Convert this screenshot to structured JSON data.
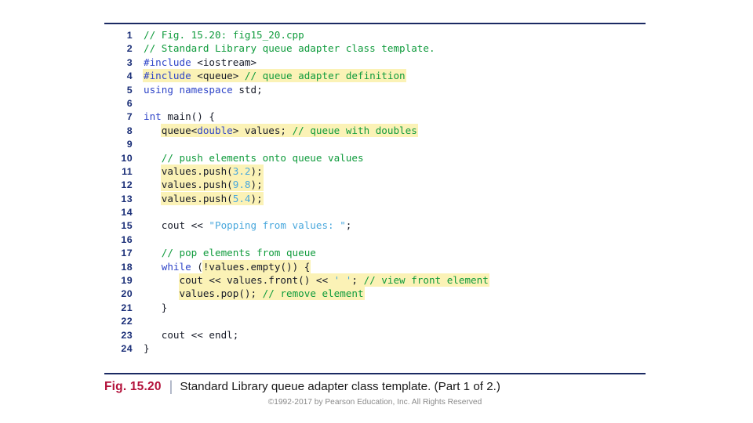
{
  "figure": {
    "label": "Fig. 15.20",
    "divider": "|",
    "caption": "Standard Library queue adapter class template. (Part 1 of 2.)",
    "copyright": "©1992-2017 by Pearson Education, Inc. All Rights Reserved",
    "rule_color": "#1b2a63",
    "label_color": "#b3123b"
  },
  "colors": {
    "comment": "#0f9b3c",
    "keyword": "#2f45c8",
    "preprocessor": "#2f45c8",
    "plain": "#171b28",
    "number": "#4aa8dd",
    "string": "#4aa8dd",
    "highlight": "#fbf2b6",
    "line_number": "#1b2f78"
  },
  "code": {
    "language": "cpp",
    "filename": "fig15_20.cpp",
    "first_line": 1,
    "last_line": 24,
    "lines": [
      {
        "n": "1",
        "text": "// Fig. 15.20: fig15_20.cpp"
      },
      {
        "n": "2",
        "text": "// Standard Library queue adapter class template."
      },
      {
        "n": "3",
        "text": "#include <iostream>"
      },
      {
        "n": "4",
        "text": "#include <queue> // queue adapter definition"
      },
      {
        "n": "5",
        "text": "using namespace std;"
      },
      {
        "n": "6",
        "text": ""
      },
      {
        "n": "7",
        "text": "int main() {"
      },
      {
        "n": "8",
        "text": "   queue<double> values; // queue with doubles"
      },
      {
        "n": "9",
        "text": ""
      },
      {
        "n": "10",
        "text": "   // push elements onto queue values"
      },
      {
        "n": "11",
        "text": "   values.push(3.2);"
      },
      {
        "n": "12",
        "text": "   values.push(9.8);"
      },
      {
        "n": "13",
        "text": "   values.push(5.4);"
      },
      {
        "n": "14",
        "text": ""
      },
      {
        "n": "15",
        "text": "   cout << \"Popping from values: \";"
      },
      {
        "n": "16",
        "text": ""
      },
      {
        "n": "17",
        "text": "   // pop elements from queue"
      },
      {
        "n": "18",
        "text": "   while (!values.empty()) {"
      },
      {
        "n": "19",
        "text": "      cout << values.front() << ' '; // view front element"
      },
      {
        "n": "20",
        "text": "      values.pop(); // remove element"
      },
      {
        "n": "21",
        "text": "   }"
      },
      {
        "n": "22",
        "text": ""
      },
      {
        "n": "23",
        "text": "   cout << endl;"
      },
      {
        "n": "24",
        "text": "}"
      }
    ],
    "highlighted_lines": [
      "4",
      "8",
      "11",
      "12",
      "13",
      "18",
      "19",
      "20"
    ]
  }
}
